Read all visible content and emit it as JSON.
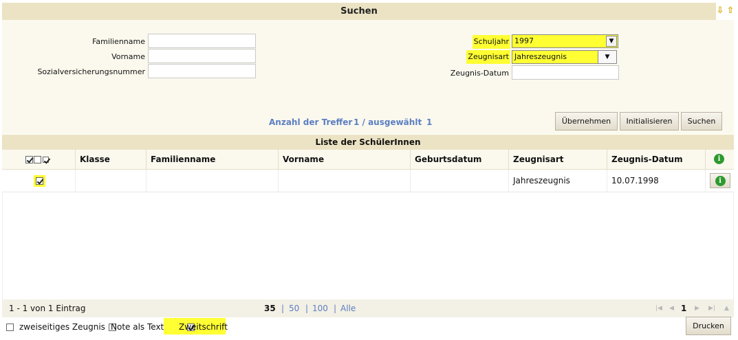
{
  "search": {
    "title": "Suchen",
    "familienname_label": "Familienname",
    "vorname_label": "Vorname",
    "svnr_label": "Sozialversicherungsnummer",
    "familienname_value": "",
    "vorname_value": "",
    "svnr_value": "",
    "schuljahr_label": "Schuljahr",
    "schuljahr_value": "1997",
    "zeugnisart_label": "Zeugnisart",
    "zeugnisart_value": "Jahreszeugnis",
    "zeugnisdatum_label": "Zeugnis-Datum",
    "zeugnisdatum_value": ""
  },
  "stats": {
    "treffer_label": "Anzahl der Treffer",
    "treffer_count": "1 / ausgewählt",
    "selected_count": "1"
  },
  "buttons": {
    "uebernehmen": "Übernehmen",
    "initialisieren": "Initialisieren",
    "suchen": "Suchen",
    "drucken": "Drucken"
  },
  "list": {
    "title": "Liste der SchülerInnen",
    "columns": [
      "Klasse",
      "Familienname",
      "Vorname",
      "Geburtsdatum",
      "Zeugnisart",
      "Zeugnis-Datum"
    ],
    "rows": [
      {
        "klasse": "",
        "familienname": "",
        "vorname": "",
        "geburtsdatum": "",
        "zeugnisart": "Jahreszeugnis",
        "zeugnisdatum": "10.07.1998",
        "selected": true
      }
    ]
  },
  "pager": {
    "summary": "1 - 1 von 1 Eintrag",
    "size_current": "35",
    "size_50": "50",
    "size_100": "100",
    "size_all": "Alle",
    "page": "1"
  },
  "options": {
    "zweiseitig": "zweiseitiges Zeugnis",
    "note_text": "Note als Text",
    "zweitschrift": "Zweitschrift"
  },
  "colors": {
    "header_bg": "#ece3c4",
    "highlight": "#ffff33",
    "link": "#5b7ec2",
    "info": "#2e9a2e"
  }
}
